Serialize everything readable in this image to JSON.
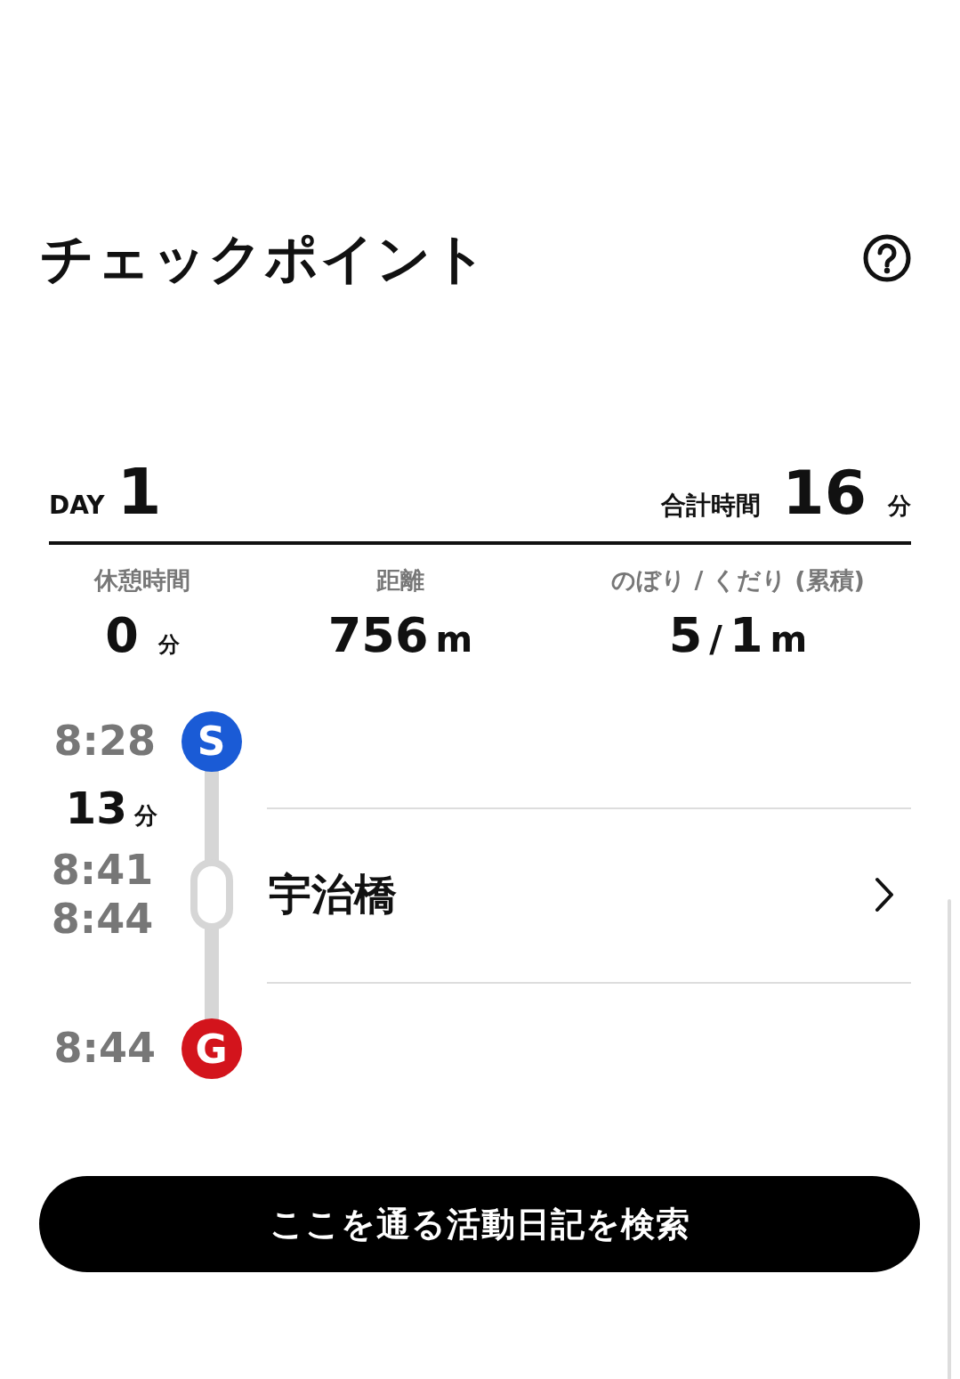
{
  "header": {
    "title": "チェックポイント"
  },
  "day": {
    "label": "DAY",
    "number": "1",
    "total_label": "合計時間",
    "total_value": "16",
    "total_unit": "分"
  },
  "stats": [
    {
      "label": "休憩時間",
      "value": "0",
      "unit": "分"
    },
    {
      "label": "距離",
      "value": "756",
      "unit": "m"
    },
    {
      "label": "のぼり / くだり (累積)",
      "value": "5",
      "separator": "/",
      "value2": "1",
      "unit": "m"
    }
  ],
  "timeline": {
    "start": {
      "time": "8:28",
      "mark": "S"
    },
    "duration": {
      "value": "13",
      "unit": "分"
    },
    "checkpoints": [
      {
        "arrive": "8:41",
        "depart": "8:44",
        "name": "宇治橋"
      }
    ],
    "goal": {
      "time": "8:44",
      "mark": "G"
    }
  },
  "search_button": "ここを通る活動日記を検索"
}
